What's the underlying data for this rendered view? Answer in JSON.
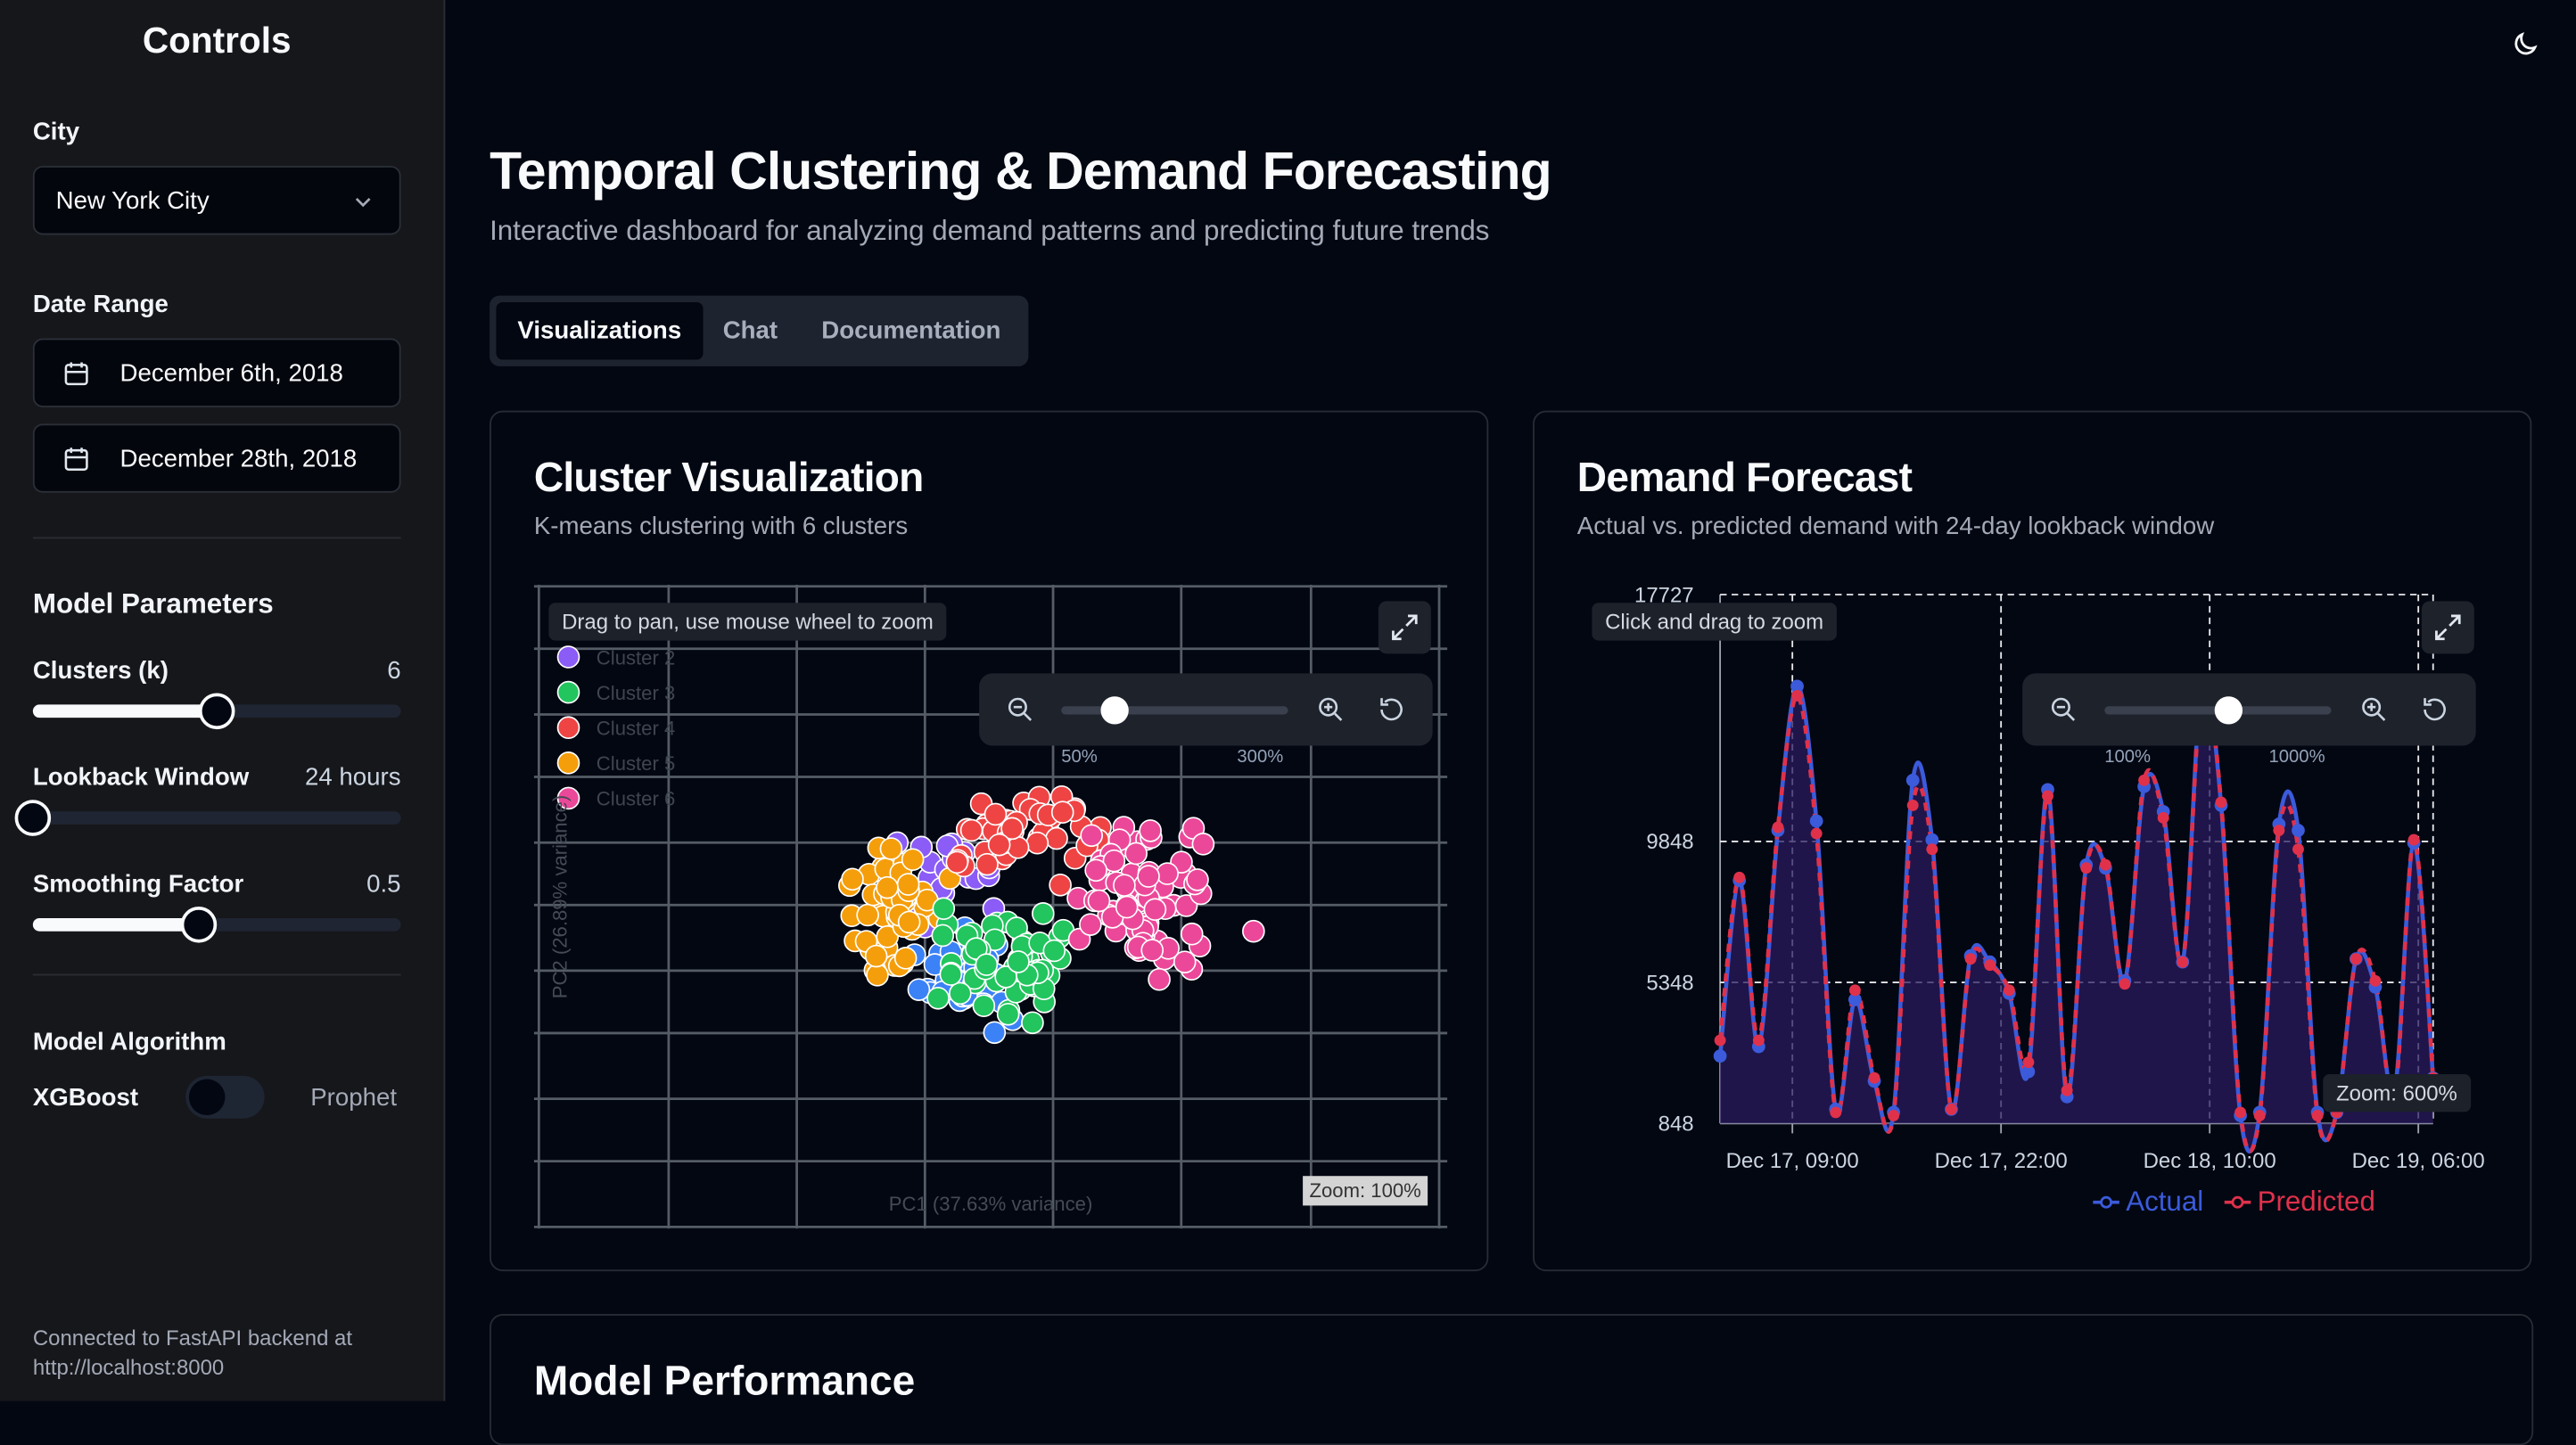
{
  "sidebar": {
    "title": "Controls",
    "city_label": "City",
    "city_value": "New York City",
    "date_range_label": "Date Range",
    "start_date": "December 6th, 2018",
    "end_date": "December 28th, 2018",
    "model_params_title": "Model Parameters",
    "clusters_label": "Clusters (k)",
    "clusters_value": "6",
    "clusters_fraction": 0.5,
    "lookback_label": "Lookback Window",
    "lookback_value": "24 hours",
    "lookback_fraction": 0.0,
    "smoothing_label": "Smoothing Factor",
    "smoothing_value": "0.5",
    "smoothing_fraction": 0.45,
    "algorithm_label": "Model Algorithm",
    "algo_left": "XGBoost",
    "algo_right": "Prophet",
    "footer": "Connected to FastAPI backend at http://localhost:8000"
  },
  "header": {
    "title": "Temporal Clustering & Demand Forecasting",
    "subtitle": "Interactive dashboard for analyzing demand patterns and predicting future trends",
    "tabs": [
      "Visualizations",
      "Chat",
      "Documentation"
    ],
    "active_tab": 0
  },
  "cluster_card": {
    "title": "Cluster Visualization",
    "subtitle": "K-means clustering with 6 clusters",
    "hint": "Drag to pan, use mouse wheel to zoom",
    "zoom_min": "50%",
    "zoom_max": "300%",
    "zoom_label": "Zoom: 100%",
    "legend": [
      "Cluster 2",
      "Cluster 3",
      "Cluster 4",
      "Cluster 5",
      "Cluster 6"
    ],
    "xlabel": "PC1 (37.63% variance)",
    "ylabel": "PC2 (26.89% variance)"
  },
  "forecast_card": {
    "title": "Demand Forecast",
    "subtitle": "Actual vs. predicted demand with 24-day lookback window",
    "hint": "Click and drag to zoom",
    "zoom_min": "100%",
    "zoom_max": "1000%",
    "zoom_label": "Zoom: 600%"
  },
  "performance_card": {
    "title": "Model Performance"
  },
  "colors": {
    "actual": "#3b5bdb",
    "predicted": "#e0314b",
    "cluster_purple": "#8b5cf6",
    "cluster_blue": "#3b82f6",
    "cluster_green": "#22c55e",
    "cluster_red": "#ef4444",
    "cluster_orange": "#f59e0b",
    "cluster_pink": "#ec4899"
  },
  "chart_data": [
    {
      "type": "scatter",
      "title": "Cluster Visualization",
      "xlabel": "PC1 (37.63% variance)",
      "ylabel": "PC2 (26.89% variance)",
      "series": [
        {
          "name": "Cluster 2",
          "color": "#8b5cf6"
        },
        {
          "name": "Cluster 3",
          "color": "#22c55e"
        },
        {
          "name": "Cluster 4",
          "color": "#ef4444"
        },
        {
          "name": "Cluster 5",
          "color": "#f59e0b"
        },
        {
          "name": "Cluster 6",
          "color": "#ec4899"
        }
      ],
      "grid": true
    },
    {
      "type": "line",
      "title": "Demand Forecast",
      "x_ticks": [
        "Dec 17, 09:00",
        "Dec 17, 22:00",
        "Dec 18, 10:00",
        "Dec 19, 06:00"
      ],
      "y_ticks": [
        "848",
        "5348",
        "9848",
        "17727"
      ],
      "ylim": [
        848,
        17727
      ],
      "legend": [
        "Actual",
        "Predicted"
      ],
      "series": [
        {
          "name": "Actual",
          "values": [
            3000,
            8600,
            3300,
            10200,
            14800,
            10500,
            1300,
            4800,
            2200,
            1200,
            11800,
            9900,
            1300,
            6200,
            6000,
            5000,
            2500,
            11500,
            1700,
            9100,
            9000,
            5400,
            11600,
            10800,
            6000,
            14900,
            11000,
            1100,
            1200,
            10400,
            10200,
            1200,
            1200,
            6100,
            5200,
            1900,
            9800,
            2300
          ]
        },
        {
          "name": "Predicted",
          "values": [
            3500,
            8700,
            3500,
            10300,
            14500,
            10100,
            1200,
            5100,
            2300,
            1100,
            11000,
            9600,
            1300,
            6100,
            5900,
            5100,
            2800,
            11300,
            1900,
            9000,
            9100,
            5300,
            11800,
            10600,
            6000,
            14700,
            11100,
            1200,
            1100,
            10200,
            9600,
            1100,
            1200,
            6100,
            5400,
            1700,
            9900,
            2300
          ]
        }
      ]
    }
  ]
}
